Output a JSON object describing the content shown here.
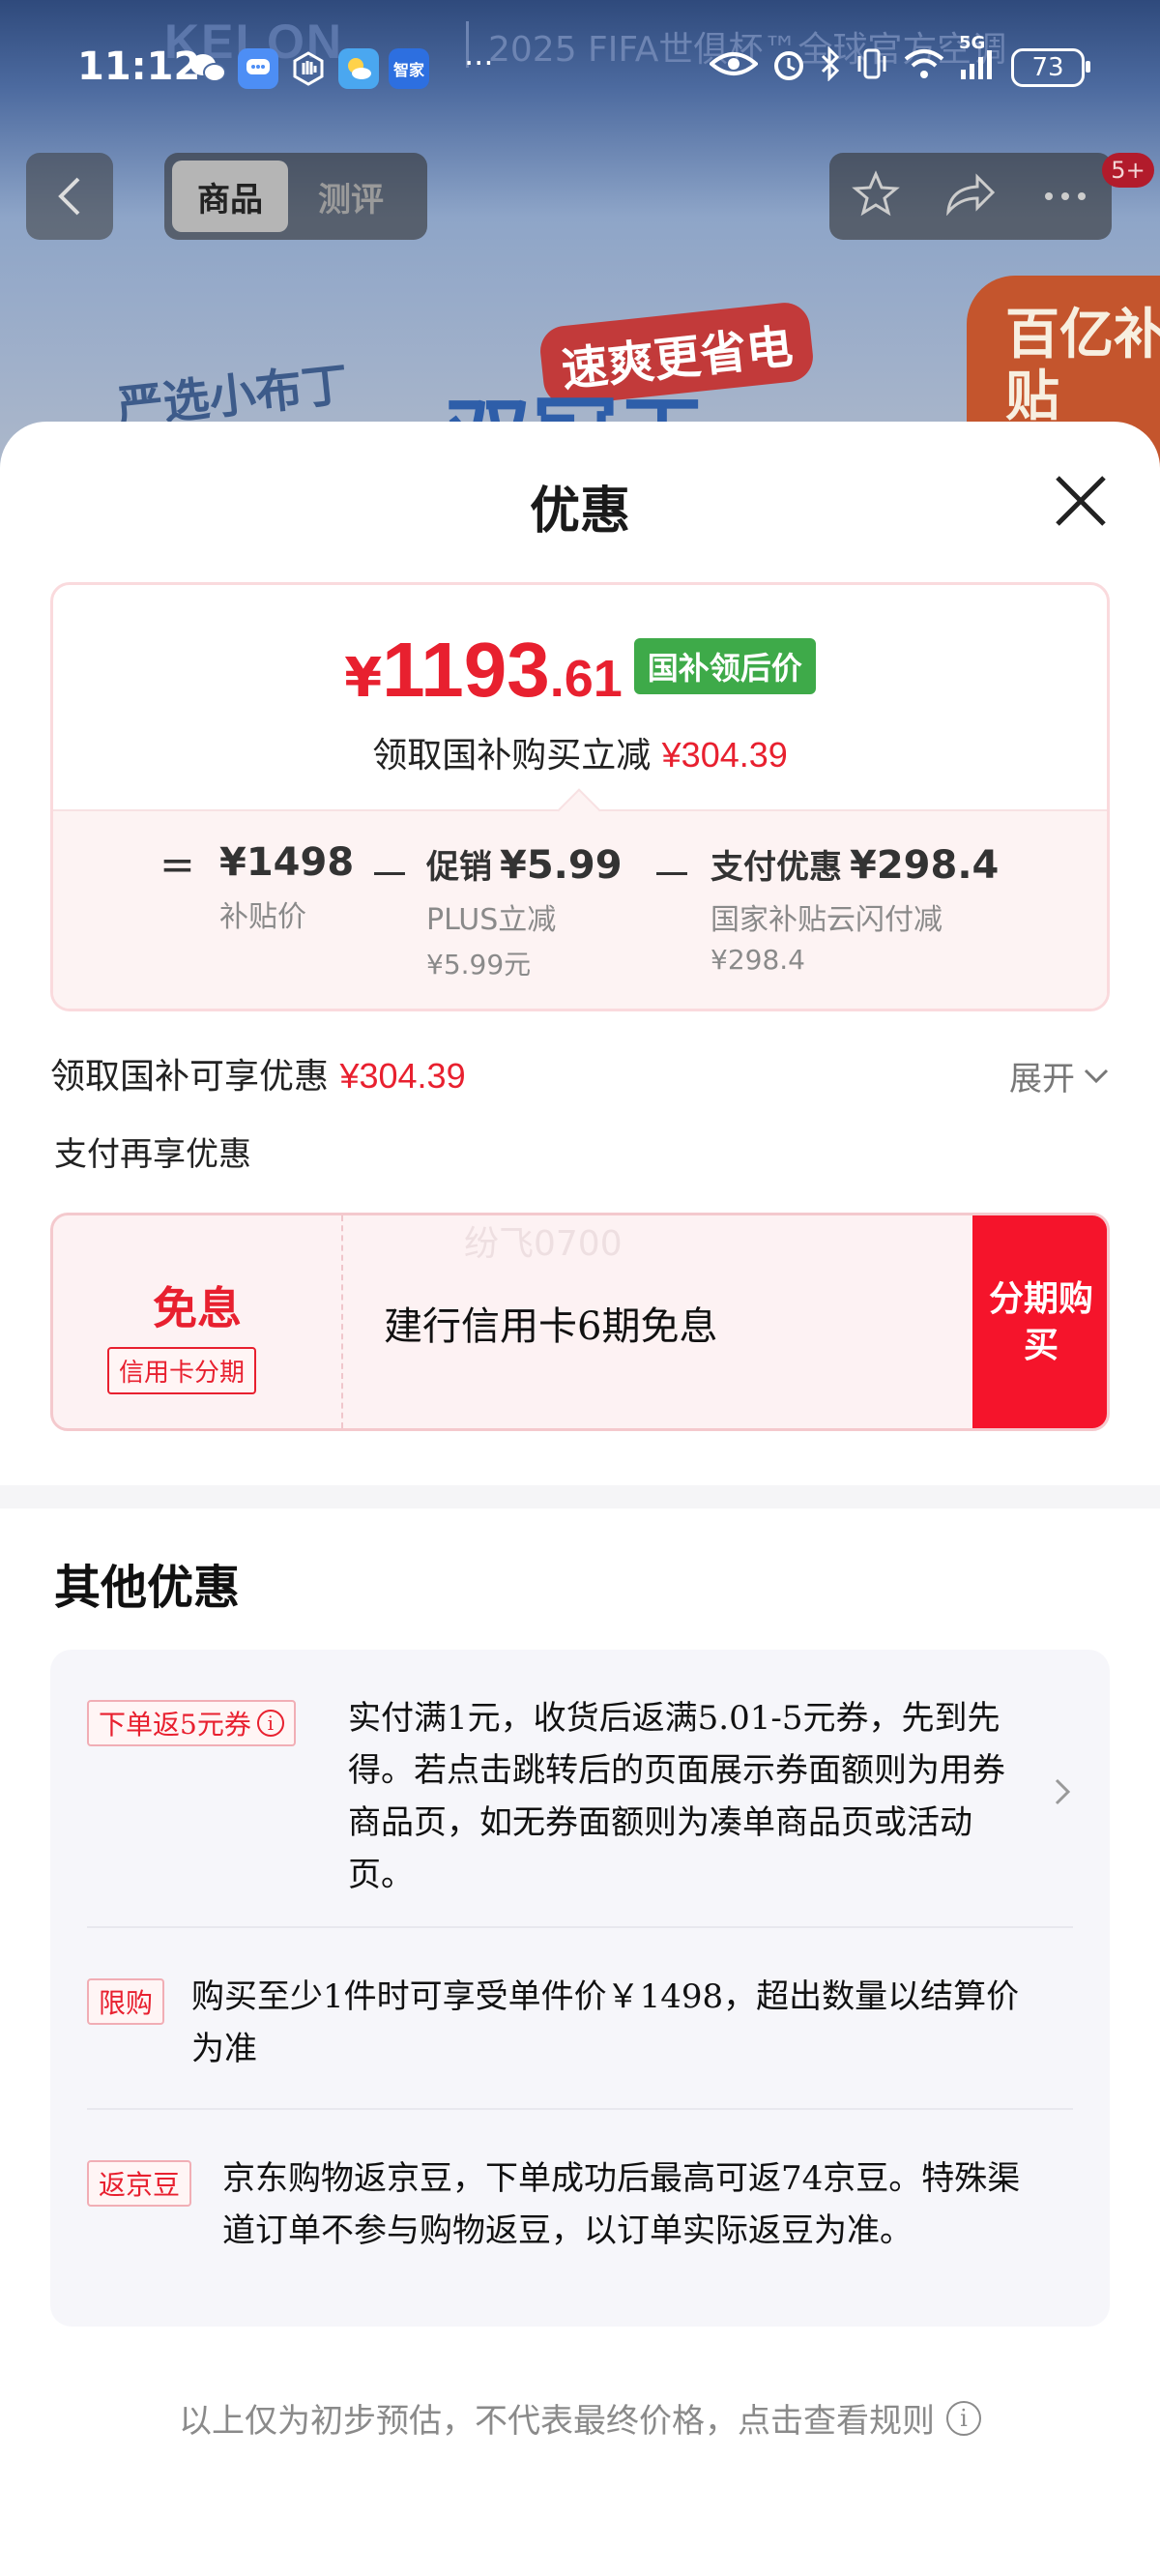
{
  "status_bar": {
    "time": "11:12",
    "more_dots": "···",
    "network": "5G",
    "battery": "73",
    "app_label": "智家"
  },
  "background": {
    "brand": "KELON",
    "banner_subtitle": "2025 FIFA世俱杯™全球官方空调",
    "promo": "速爽更省电",
    "subsidy_badge": "百亿补贴",
    "tabs": [
      "商品",
      "测评"
    ],
    "notification_badge": "5+"
  },
  "sheet": {
    "title": "优惠",
    "price_card": {
      "currency": "¥",
      "price_int": "1193",
      "price_dec": ".61",
      "price_tag": "国补领后价",
      "subtitle_prefix": "领取国补购买立减",
      "subtitle_amount": "¥304.39",
      "breakdown": {
        "eq": "=",
        "minus": "－",
        "col1_main": "¥1498",
        "col1_l2": "补贴价",
        "col2_label": "促销",
        "col2_value": "¥5.99",
        "col2_l2": "PLUS立减",
        "col2_l3": "¥5.99元",
        "col3_label": "支付优惠",
        "col3_value": "¥298.4",
        "col3_l2": "国家补贴云闪付减",
        "col3_l3": "¥298.4"
      }
    },
    "enjoy": {
      "label": "领取国补可享优惠",
      "amount": "¥304.39",
      "expand": "展开"
    },
    "pay_section_title": "支付再享优惠",
    "pay_card": {
      "big": "免息",
      "small": "信用卡分期",
      "watermark": "纷飞0700",
      "text": "建行信用卡6期免息",
      "button": "分期购买"
    },
    "other_title": "其他优惠",
    "other_items": [
      {
        "tag": "下单返5元券",
        "text": "实付满1元，收货后返满5.01-5元券，先到先得。若点击跳转后的页面展示券面额则为用券商品页，如无券面额则为凑单商品页或活动页。"
      },
      {
        "tag": "限购",
        "text": "购买至少1件时可享受单件价￥1498，超出数量以结算价为准"
      },
      {
        "tag": "返京豆",
        "text": "京东购物返京豆，下单成功后最高可返74京豆。特殊渠道订单不参与购物返豆，以订单实际返豆为准。"
      }
    ],
    "footer": "以上仅为初步预估，不代表最终价格，点击查看规则"
  },
  "colors": {
    "accent_red": "#e8202f",
    "tag_green": "#3eaa49",
    "button_red": "#f5142b"
  }
}
